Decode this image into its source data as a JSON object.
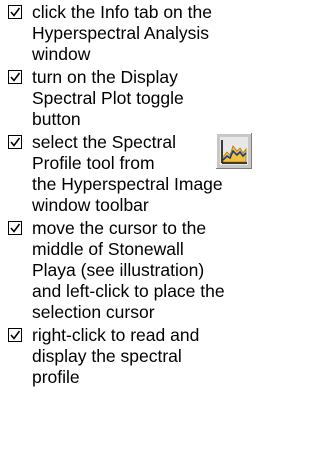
{
  "checklist": {
    "items": [
      {
        "checked": true,
        "lines": [
          "click the Info tab on the",
          "Hyperspectral Analysis",
          "window"
        ]
      },
      {
        "checked": true,
        "lines": [
          "turn on the Display",
          "Spectral Plot toggle",
          "button"
        ]
      },
      {
        "checked": true,
        "lines": [
          "select the Spectral",
          "Profile tool from",
          "the Hyperspectral Image",
          "window toolbar"
        ],
        "icon": "spectral-profile-tool-icon"
      },
      {
        "checked": true,
        "lines": [
          "move the cursor to the",
          "middle of Stonewall",
          "Playa (see illustration)",
          "and left-click to place the",
          "selection cursor"
        ]
      },
      {
        "checked": true,
        "lines": [
          "right-click to read and",
          "display the spectral",
          "profile"
        ]
      }
    ]
  },
  "colors": {
    "text": "#000000",
    "icon_border_light": "#ffffff",
    "icon_border_dark": "#808080",
    "icon_face": "#c8c8c8",
    "icon_chart_fill": "#f0c040",
    "icon_chart_line": "#1a3a8a"
  }
}
